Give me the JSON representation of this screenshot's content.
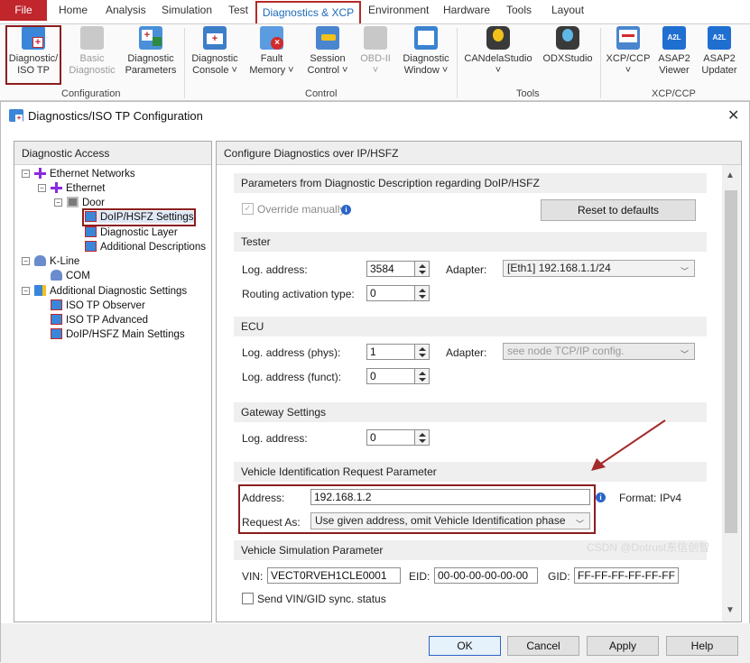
{
  "tabs": {
    "file": "File",
    "home": "Home",
    "analysis": "Analysis",
    "simulation": "Simulation",
    "test": "Test",
    "diagnostics": "Diagnostics & XCP",
    "environment": "Environment",
    "hardware": "Hardware",
    "tools": "Tools",
    "layout": "Layout"
  },
  "ribbon": {
    "groups": {
      "configuration": "Configuration",
      "control": "Control",
      "tools": "Tools",
      "xcp": "XCP/CCP"
    },
    "buttons": {
      "diag_iso": [
        "Diagnostic/",
        "ISO TP"
      ],
      "basic_diag": [
        "Basic",
        "Diagnostic"
      ],
      "diag_params": [
        "Diagnostic",
        "Parameters"
      ],
      "diag_console": [
        "Diagnostic",
        "Console ˅"
      ],
      "fault_memory": [
        "Fault",
        "Memory ˅"
      ],
      "session_control": [
        "Session",
        "Control ˅"
      ],
      "obd2": [
        "OBD-II",
        "˅"
      ],
      "diag_window": [
        "Diagnostic",
        "Window ˅"
      ],
      "candela": [
        "CANdelaStudio",
        "˅"
      ],
      "odx": [
        "ODXStudio",
        ""
      ],
      "xcp_ccp": [
        "XCP/CCP",
        "˅"
      ],
      "asap2_viewer": [
        "ASAP2",
        "Viewer"
      ],
      "asap2_updater": [
        "ASAP2",
        "Updater"
      ]
    }
  },
  "dialog": {
    "title": "Diagnostics/ISO TP Configuration",
    "left_header": "Diagnostic Access",
    "tree": {
      "ethernet_networks": "Ethernet Networks",
      "ethernet": "Ethernet",
      "door": "Door",
      "doip_settings": "DoIP/HSFZ Settings",
      "diag_layer": "Diagnostic Layer",
      "additional_desc": "Additional Descriptions",
      "kline": "K-Line",
      "com": "COM",
      "additional_diag": "Additional Diagnostic Settings",
      "iso_observer": "ISO TP Observer",
      "iso_advanced": "ISO TP Advanced",
      "doip_main": "DoIP/HSFZ Main Settings"
    },
    "right_header": "Configure Diagnostics over IP/HSFZ",
    "sections": {
      "params": "Parameters from Diagnostic Description regarding DoIP/HSFZ",
      "tester": "Tester",
      "ecu": "ECU",
      "gateway": "Gateway Settings",
      "vehicle_id": "Vehicle Identification Request Parameter",
      "vehicle_sim": "Vehicle Simulation Parameter"
    },
    "override_label": "Override manually",
    "reset_button": "Reset to defaults",
    "tester": {
      "log_address_label": "Log. address:",
      "log_address": "3584",
      "adapter_label": "Adapter:",
      "adapter": "[Eth1]  192.168.1.1/24",
      "routing_label": "Routing activation type:",
      "routing": "0"
    },
    "ecu": {
      "phys_label": "Log. address (phys):",
      "phys": "1",
      "adapter_label": "Adapter:",
      "adapter": "see node TCP/IP config.",
      "funct_label": "Log. address (funct):",
      "funct": "0"
    },
    "gateway": {
      "log_address_label": "Log. address:",
      "log_address": "0"
    },
    "vehicle_id": {
      "address_label": "Address:",
      "address": "192.168.1.2",
      "format_label": "Format:",
      "format": "IPv4",
      "request_label": "Request As:",
      "request": "Use given address, omit Vehicle Identification phase"
    },
    "vehicle_sim": {
      "vin_label": "VIN:",
      "vin": "VECT0RVEH1CLE0001",
      "eid_label": "EID:",
      "eid": "00-00-00-00-00-00",
      "gid_label": "GID:",
      "gid": "FF-FF-FF-FF-FF-FF",
      "sync_label": "Send VIN/GID sync. status"
    },
    "buttons": {
      "ok": "OK",
      "cancel": "Cancel",
      "apply": "Apply",
      "help": "Help"
    }
  },
  "watermark": "CSDN @Dotrust东信创智",
  "colors": {
    "file_tab": "#c0262c",
    "highlight_box": "#8b1e1e",
    "arrow": "#a52a2a",
    "active_tab_text": "#1e6bb8",
    "info_icon": "#2a64c8"
  }
}
